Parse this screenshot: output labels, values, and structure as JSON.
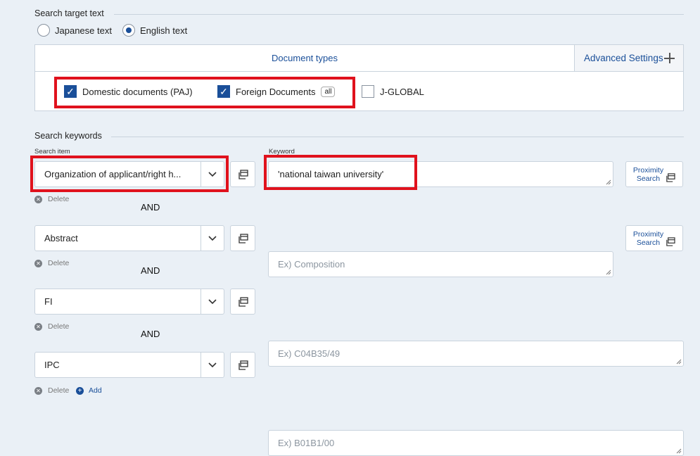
{
  "search_target": {
    "label": "Search target text",
    "options": [
      "Japanese text",
      "English text"
    ],
    "selected": "English text"
  },
  "doc_types": {
    "header": "Document types",
    "advanced_label": "Advanced Settings",
    "items": [
      {
        "label": "Domestic documents (PAJ)",
        "checked": true
      },
      {
        "label": "Foreign Documents",
        "checked": true,
        "badge": "all"
      },
      {
        "label": "J-GLOBAL",
        "checked": false
      }
    ]
  },
  "keywords": {
    "label": "Search keywords",
    "search_item_label": "Search item",
    "keyword_label": "Keyword",
    "delete_label": "Delete",
    "add_label": "Add",
    "proximity_line1": "Proximity",
    "proximity_line2": "Search",
    "connector": "AND",
    "rows": [
      {
        "item": "Organization of applicant/right h...",
        "value": "'national taiwan university'",
        "placeholder": ""
      },
      {
        "item": "Abstract",
        "value": "",
        "placeholder": "Ex) Composition"
      },
      {
        "item": "FI",
        "value": "",
        "placeholder": "Ex) C04B35/49"
      },
      {
        "item": "IPC",
        "value": "",
        "placeholder": "Ex) B01B1/00"
      }
    ]
  },
  "colors": {
    "accent": "#1a4f99",
    "highlight": "#e0121d",
    "background": "#eaf0f6"
  }
}
